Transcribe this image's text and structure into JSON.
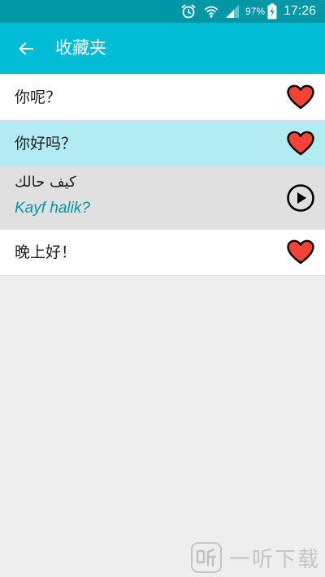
{
  "status_bar": {
    "battery_percent": "97%",
    "time": "17:26",
    "icons": [
      "alarm-icon",
      "wifi-icon",
      "signal-icon",
      "battery-charging-icon"
    ]
  },
  "app_bar": {
    "title": "收藏夹",
    "back_icon": "arrow-left-icon"
  },
  "favorites": [
    {
      "phrase": "你呢？",
      "action_icon": "heart-icon"
    },
    {
      "phrase": "你好吗？",
      "action_icon": "heart-icon",
      "highlighted": true
    },
    {
      "phrase_arabic": "كيف حالك",
      "phrase_roman": "Kayf halik?",
      "action_icon": "play-circle-icon",
      "expanded": true
    },
    {
      "phrase": "晚上好！",
      "action_icon": "heart-icon"
    }
  ],
  "watermark": {
    "text": "一听下载",
    "icon": "logo-icon"
  },
  "colors": {
    "status_bar": "#0097a7",
    "app_bar": "#00bcd4",
    "highlight_row": "#b2ebf2",
    "expanded_row": "#e0e0e0",
    "heart_fill": "#f44336",
    "roman_text": "#0097a7",
    "background": "#eeeeee"
  }
}
